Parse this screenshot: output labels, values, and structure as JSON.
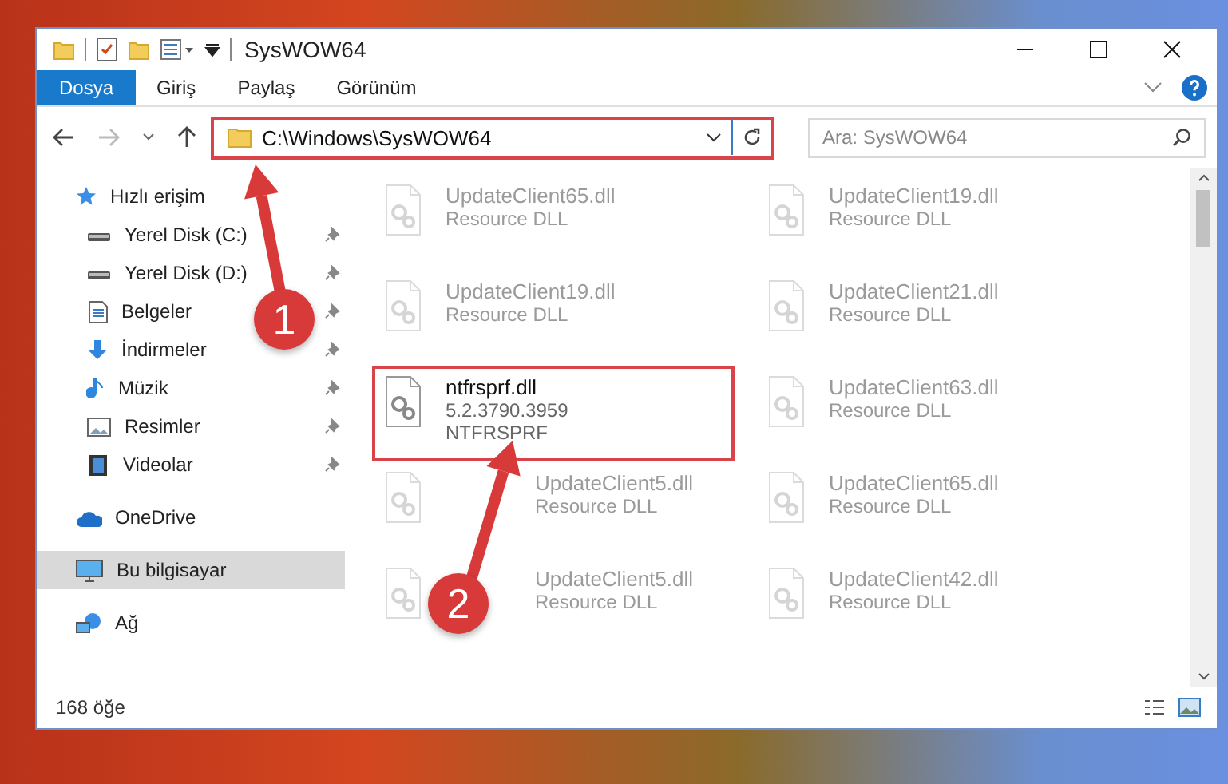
{
  "window": {
    "title": "SysWOW64"
  },
  "ribbon_tabs": [
    {
      "label": "Dosya",
      "kind": "file",
      "selected": false
    },
    {
      "label": "Giriş",
      "kind": "tab",
      "selected": false
    },
    {
      "label": "Paylaş",
      "kind": "tab",
      "selected": false
    },
    {
      "label": "Görünüm",
      "kind": "tab",
      "selected": false
    }
  ],
  "address": {
    "path": "C:\\Windows\\SysWOW64",
    "highlighted": true
  },
  "search": {
    "placeholder": "Ara: SysWOW64"
  },
  "sidebar": {
    "items": [
      {
        "label": "Hızlı erişim",
        "selected": false,
        "children": [
          {
            "label": "Yerel Disk (C:)",
            "pinned": true,
            "selected": false
          },
          {
            "label": "Yerel Disk (D:)",
            "pinned": true,
            "selected": false
          },
          {
            "label": "Belgeler",
            "pinned": true,
            "selected": false
          },
          {
            "label": "İndirmeler",
            "pinned": true,
            "selected": false
          },
          {
            "label": "Müzik",
            "pinned": true,
            "selected": false
          },
          {
            "label": "Resimler",
            "pinned": true,
            "selected": false
          },
          {
            "label": "Videolar",
            "pinned": true,
            "selected": false
          }
        ]
      },
      {
        "label": "OneDrive",
        "selected": false
      },
      {
        "label": "Bu bilgisayar",
        "selected": true
      },
      {
        "label": "Ağ",
        "selected": false
      }
    ]
  },
  "files": [
    {
      "name": "UpdateClient65.dll",
      "detail": "Resource DLL",
      "faded": true,
      "highlighted": false
    },
    {
      "name": "UpdateClient19.dll",
      "detail": "Resource DLL",
      "faded": true,
      "highlighted": false
    },
    {
      "name": "UpdateClient19.dll",
      "detail": "Resource DLL",
      "faded": true,
      "highlighted": false
    },
    {
      "name": "UpdateClient21.dll",
      "detail": "Resource DLL",
      "faded": true,
      "highlighted": false
    },
    {
      "name": "ntfrsprf.dll",
      "version": "5.2.3790.3959",
      "detail": "NTFRSPRF",
      "faded": false,
      "highlighted": true
    },
    {
      "name": "UpdateClient63.dll",
      "detail": "Resource DLL",
      "faded": true,
      "highlighted": false
    },
    {
      "name": "UpdateClient5.dll",
      "detail": "Resource DLL",
      "faded": true,
      "highlighted": false,
      "behind_callout": true
    },
    {
      "name": "UpdateClient65.dll",
      "detail": "Resource DLL",
      "faded": true,
      "highlighted": false
    },
    {
      "name": "UpdateClient5.dll",
      "detail": "Resource DLL",
      "faded": true,
      "highlighted": false,
      "behind_callout": true
    },
    {
      "name": "UpdateClient42.dll",
      "detail": "Resource DLL",
      "faded": true,
      "highlighted": false
    }
  ],
  "status_bar": {
    "count": "168 öğe"
  },
  "callouts": [
    {
      "label": "1"
    },
    {
      "label": "2"
    }
  ]
}
